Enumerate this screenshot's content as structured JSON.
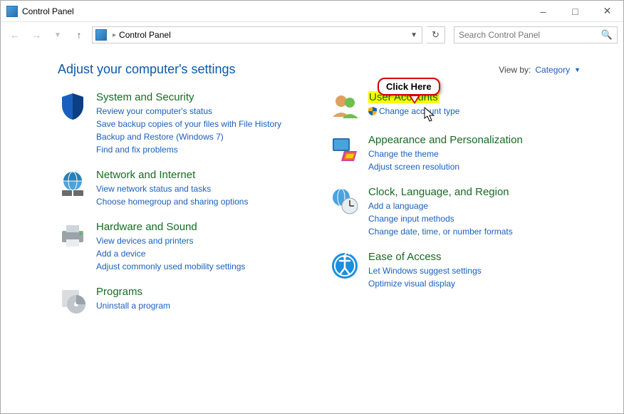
{
  "window": {
    "title": "Control Panel"
  },
  "nav": {
    "breadcrumb": "Control Panel",
    "search_placeholder": "Search Control Panel"
  },
  "heading": "Adjust your computer's settings",
  "viewby": {
    "label": "View by:",
    "value": "Category"
  },
  "callout": "Click Here",
  "left_col": [
    {
      "title": "System and Security",
      "links": [
        "Review your computer's status",
        "Save backup copies of your files with File History",
        "Backup and Restore (Windows 7)",
        "Find and fix problems"
      ]
    },
    {
      "title": "Network and Internet",
      "links": [
        "View network status and tasks",
        "Choose homegroup and sharing options"
      ]
    },
    {
      "title": "Hardware and Sound",
      "links": [
        "View devices and printers",
        "Add a device",
        "Adjust commonly used mobility settings"
      ]
    },
    {
      "title": "Programs",
      "links": [
        "Uninstall a program"
      ]
    }
  ],
  "right_col": [
    {
      "title": "User Accounts",
      "links": [
        "Change account type"
      ],
      "shield_link": true,
      "highlight": true
    },
    {
      "title": "Appearance and Personalization",
      "links": [
        "Change the theme",
        "Adjust screen resolution"
      ]
    },
    {
      "title": "Clock, Language, and Region",
      "links": [
        "Add a language",
        "Change input methods",
        "Change date, time, or number formats"
      ]
    },
    {
      "title": "Ease of Access",
      "links": [
        "Let Windows suggest settings",
        "Optimize visual display"
      ]
    }
  ]
}
